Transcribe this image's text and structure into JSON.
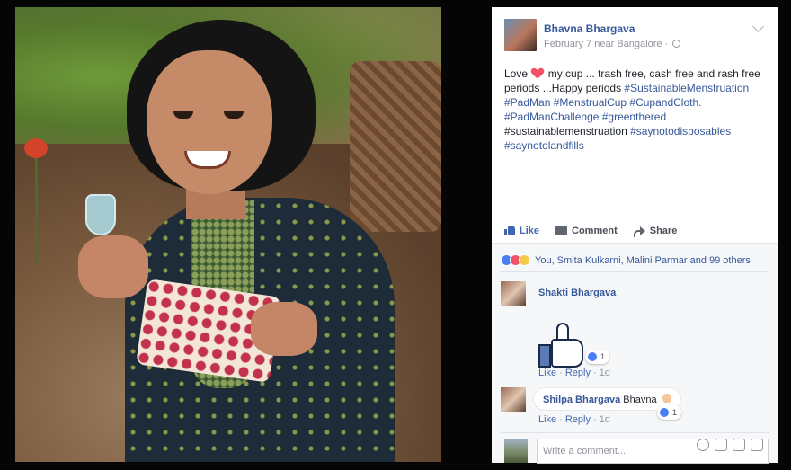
{
  "post": {
    "author": "Bhavna Bhargava",
    "date_location": "February 7 near Bangalore ·",
    "body": {
      "line1_prefix": "Love",
      "line1_suffix": " my cup ... trash free, cash free and rash free periods ...Happy periods",
      "hashtags_1": "#SustainableMenstruation #PadMan #MenstrualCup #CupandCloth. #PadManChallenge #greenthered",
      "plain_tag": "#sustainablemenstruation",
      "hashtags_2": " #saynotodisposables #saynotolandfills"
    },
    "actions": {
      "like": "Like",
      "comment": "Comment",
      "share": "Share"
    },
    "reactions_summary": "You, Smita Kulkarni, Malini Parmar and 99 others"
  },
  "comments": [
    {
      "name": "Shakti Bhargava",
      "sticker": "thumbs-up",
      "reaction_count": "1",
      "like": "Like",
      "reply": "Reply",
      "time": "1d"
    },
    {
      "name": "Shilpa Bhargava",
      "text": "Bhavna",
      "reaction_count": "1",
      "like": "Like",
      "reply": "Reply",
      "time": "1d"
    }
  ],
  "composer": {
    "placeholder": "Write a comment..."
  },
  "colors": {
    "link": "#365899",
    "like_blue": "#4267b2",
    "heart": "#f25268"
  }
}
